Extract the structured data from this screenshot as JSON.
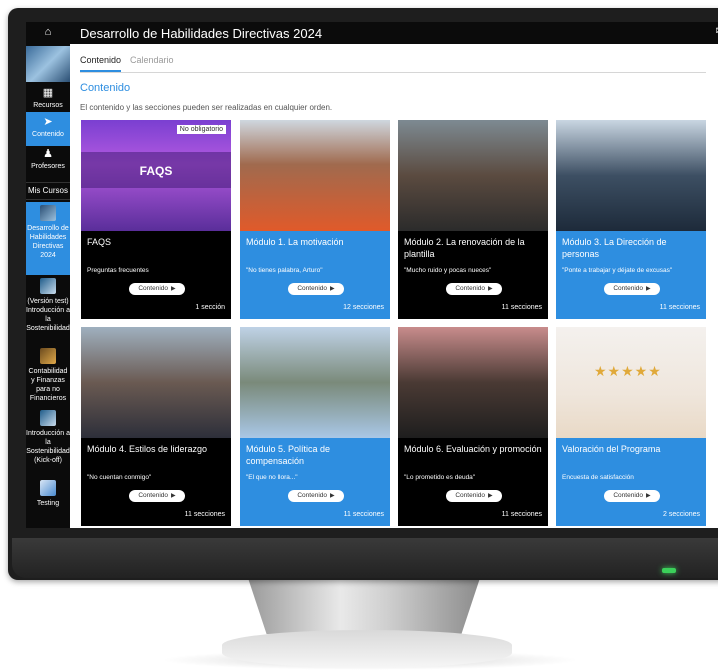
{
  "sidebar": {
    "home_icon": "home-icon",
    "items": [
      {
        "label": "Recursos",
        "icon": "resources-icon"
      },
      {
        "label": "Contenido",
        "icon": "navigation-arrow-icon"
      },
      {
        "label": "Profesores",
        "icon": "person-icon"
      }
    ],
    "mis_cursos": "Mis Cursos",
    "courses": [
      {
        "label": "Desarrollo de Habilidades Directivas 2024"
      },
      {
        "label": "(Versión test) Introducción a la Sostenibilidad"
      },
      {
        "label": "Contabilidad y Finanzas para no Financieros"
      },
      {
        "label": "Introducción a la Sostenibilidad (Kick-off)"
      },
      {
        "label": "Testing"
      }
    ]
  },
  "header": {
    "title": "Desarrollo de Habilidades Directivas 2024",
    "mail_icon": "mail-icon"
  },
  "tabs": [
    {
      "label": "Contenido"
    },
    {
      "label": "Calendario"
    }
  ],
  "main": {
    "section_title": "Contenido",
    "subtitle": "El contenido y las secciones pueden ser realizadas en cualquier orden.",
    "button_label": "Contenido",
    "cards": [
      {
        "title": "FAQS",
        "desc": "Preguntas frecuentes",
        "count": "1 sección",
        "badge": "No obligatorio",
        "image_text": "FAQS",
        "panel_color": "#000000"
      },
      {
        "title": "Módulo 1. La motivación",
        "desc": "\"No tienes palabra, Arturo\"",
        "count": "12 secciones",
        "panel_color": "#2e8ee0"
      },
      {
        "title": "Módulo 2. La renovación de la plantilla",
        "desc": "\"Mucho ruido y pocas nueces\"",
        "count": "11 secciones",
        "panel_color": "#000000"
      },
      {
        "title": "Módulo 3. La Dirección de personas",
        "desc": "\"Ponte a trabajar y déjate de excusas\"",
        "count": "11 secciones",
        "panel_color": "#2e8ee0"
      },
      {
        "title": "Módulo 4. Estilos de liderazgo",
        "desc": "\"No cuentan conmigo\"",
        "count": "11 secciones",
        "panel_color": "#000000"
      },
      {
        "title": "Módulo 5. Política de compensación",
        "desc": "\"El que no llora...\"",
        "count": "11 secciones",
        "panel_color": "#2e8ee0"
      },
      {
        "title": "Módulo 6. Evaluación y promoción",
        "desc": "\"Lo prometido es deuda\"",
        "count": "11 secciones",
        "panel_color": "#000000"
      },
      {
        "title": "Valoración del Programa",
        "desc": "Encuesta de satisfacción",
        "count": "2 secciones",
        "panel_color": "#2e8ee0"
      }
    ]
  },
  "colors": {
    "accent": "#2e8ee0",
    "sidebar": "#0b0b0b"
  }
}
